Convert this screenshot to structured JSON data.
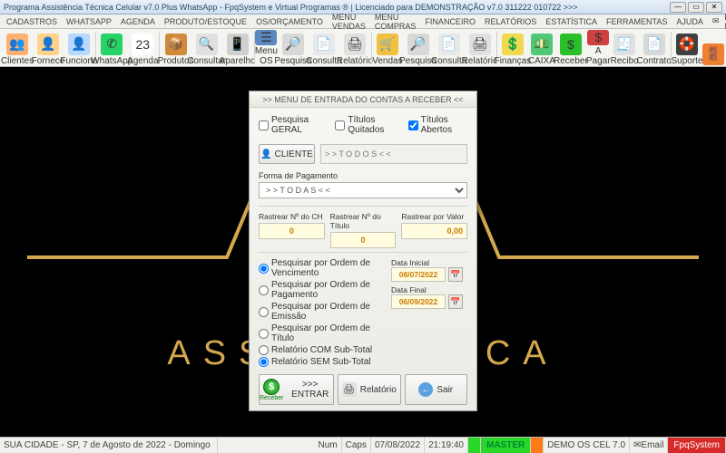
{
  "titlebar": {
    "text": "Programa Assistência Técnica Celular v7.0 Plus WhatsApp - FpqSystem e Virtual Programas ® | Licenciado para  DEMONSTRAÇÃO v7.0 311222 010722  >>>"
  },
  "menu": {
    "items": [
      "CADASTROS",
      "WHATSAPP",
      "AGENDA",
      "PRODUTO/ESTOQUE",
      "OS/ORÇAMENTO",
      "MENU VENDAS",
      "MENU COMPRAS",
      "FINANCEIRO",
      "RELATÓRIOS",
      "ESTATÍSTICA",
      "FERRAMENTAS",
      "AJUDA"
    ],
    "email": "E-MAIL"
  },
  "toolbar": {
    "items": [
      {
        "label": "Clientes",
        "icon": "👥",
        "tone": "#ffb070"
      },
      {
        "label": "Fornece",
        "icon": "👤",
        "tone": "#ffd28a"
      },
      {
        "label": "Funciona",
        "icon": "👤",
        "tone": "#b8d8ff"
      },
      {
        "label": "WhatsApp",
        "icon": "✆",
        "tone": "#25d366"
      },
      {
        "label": "Agenda",
        "icon": "23",
        "tone": "#ffffff"
      },
      {
        "label": "Produtos",
        "icon": "📦",
        "tone": "#d08a3a"
      },
      {
        "label": "Consultar",
        "icon": "🔍",
        "tone": "#e0e0e0"
      },
      {
        "label": "Aparelho",
        "icon": "📱",
        "tone": "#d0d0d0"
      },
      {
        "label": "Menu OS",
        "icon": "☰",
        "tone": "#5a88c0"
      },
      {
        "label": "Pesquisa",
        "icon": "🔎",
        "tone": "#d8d8d8"
      },
      {
        "label": "Consulta",
        "icon": "📄",
        "tone": "#e8e8e8"
      },
      {
        "label": "Relatório",
        "icon": "🖨",
        "tone": "#e0e0e0"
      },
      {
        "label": "Vendas",
        "icon": "🛒",
        "tone": "#f0c040"
      },
      {
        "label": "Pesquisa",
        "icon": "🔎",
        "tone": "#d8d8d8"
      },
      {
        "label": "Consulta",
        "icon": "📄",
        "tone": "#e8e8e8"
      },
      {
        "label": "Relatório",
        "icon": "🖨",
        "tone": "#e0e0e0"
      },
      {
        "label": "Finanças",
        "icon": "💲",
        "tone": "#f0d850"
      },
      {
        "label": "CAIXA",
        "icon": "💵",
        "tone": "#50c878"
      },
      {
        "label": "Receber",
        "icon": "$",
        "tone": "#29c029"
      },
      {
        "label": "A Pagar",
        "icon": "$",
        "tone": "#d04040"
      },
      {
        "label": "Recibo",
        "icon": "🧾",
        "tone": "#e0e0e0"
      },
      {
        "label": "Contrato",
        "icon": "📄",
        "tone": "#d8d8d8"
      },
      {
        "label": "Suporte",
        "icon": "🛟",
        "tone": "#404040"
      },
      {
        "label": "",
        "icon": "🚪",
        "tone": "#f08030"
      }
    ]
  },
  "bg": {
    "word": "ASSISTÊNCIA TÉCNICA",
    "visible": "ASSIST                   CNICA"
  },
  "dialog": {
    "title": ">> MENU DE ENTRADA DO CONTAS A RECEBER <<",
    "chk_geral": "Pesquisa GERAL",
    "chk_quitados": "Títulos Quitados",
    "chk_abertos": "Títulos Abertos",
    "btn_cliente": "CLIENTE",
    "cliente_placeholder": "> > T O D O S < <",
    "forma_label": "Forma de Pagamento",
    "forma_value": "> > T O D A S < <",
    "track": {
      "ch_label": "Rastrear Nº do CH",
      "ch_value": "0",
      "tit_label": "Rastrear Nº do Título",
      "tit_value": "0",
      "val_label": "Rastrear por Valor",
      "val_value": "0,00"
    },
    "opts": [
      "Pesquisar por Ordem de Vencimento",
      "Pesquisar por Ordem de Pagamento",
      "Pesquisar por Ordem de Emissão",
      "Pesquisar por Ordem de Título",
      "Relatório COM Sub-Total",
      "Relatório SEM Sub-Total"
    ],
    "date_initial_label": "Data Inicial",
    "date_initial": "08/07/2022",
    "date_final_label": "Data Final",
    "date_final": "06/09/2022",
    "entrar_label": ">>> ENTRAR",
    "entrar_icon_label": "Receber",
    "relatorio_label": "Relatório",
    "sair_label": "Sair"
  },
  "status": {
    "left": "SUA CIDADE - SP, 7 de Agosto de 2022 - Domingo",
    "num": "Num",
    "caps": "Caps",
    "date": "07/08/2022",
    "time": "21:19:40",
    "master": "MASTER",
    "demo": "DEMO OS CEL 7.0",
    "email": "Email",
    "fpq": "FpqSystem"
  }
}
